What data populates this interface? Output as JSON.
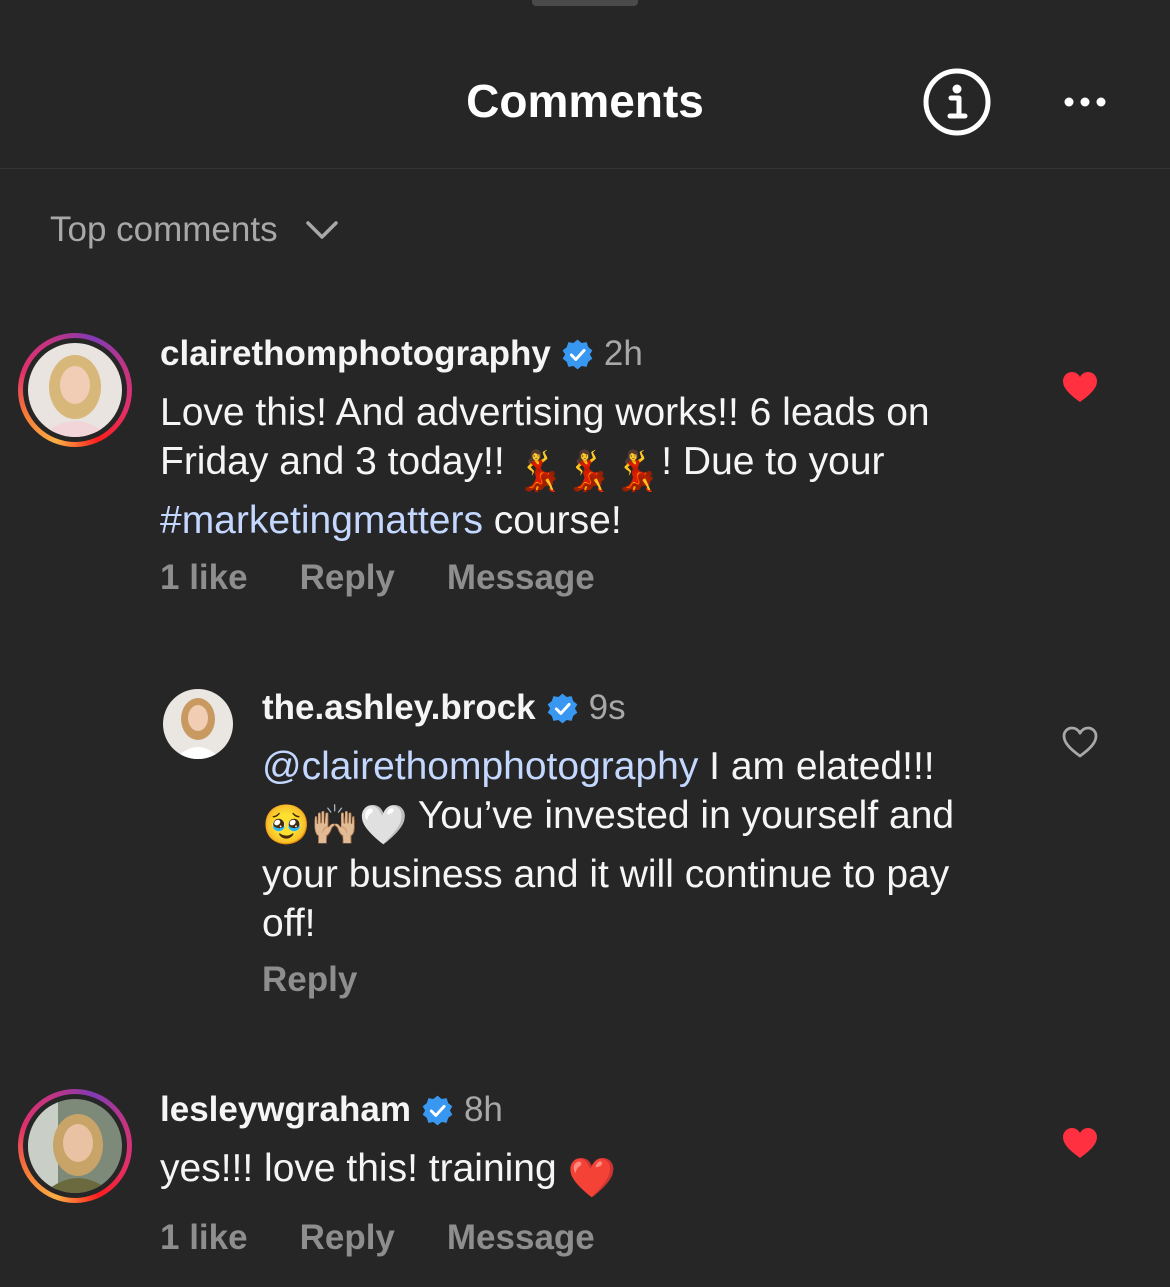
{
  "header": {
    "title": "Comments",
    "info_icon": "info-icon",
    "more_icon": "more-options-icon"
  },
  "sort": {
    "label": "Top comments",
    "icon": "chevron-down-icon"
  },
  "comments": [
    {
      "username": "clairethomphotography",
      "verified": true,
      "time": "2h",
      "text_part1": "Love this! And advertising works!! 6 leads on Friday and 3 today!! ",
      "emoji": "💃💃💃",
      "text_part2": "! Due to your ",
      "hashtag": "#marketingmatters",
      "text_part3": " course!",
      "likes": "1 like",
      "reply_label": "Reply",
      "message_label": "Message",
      "liked": true
    },
    {
      "username": "the.ashley.brock",
      "verified": true,
      "time": "9s",
      "mention": "@clairethomphotography",
      "text_part1": " I am elated!!! ",
      "emoji": "🥹🙌🏼🤍",
      "text_part2": " You’ve invested in yourself and your business and it will continue to pay off!",
      "reply_label": "Reply",
      "liked": false
    },
    {
      "username": "lesleywgraham",
      "verified": true,
      "time": "8h",
      "text_part1": "yes!!! love this! training ",
      "emoji": "❤️",
      "likes": "1 like",
      "reply_label": "Reply",
      "message_label": "Message",
      "liked": true
    }
  ],
  "colors": {
    "background": "#262626",
    "text": "#f5f5f5",
    "muted": "#8e8e8e",
    "link": "#c3d7ff",
    "verified": "#3897f0",
    "heart_active": "#ff3040"
  }
}
